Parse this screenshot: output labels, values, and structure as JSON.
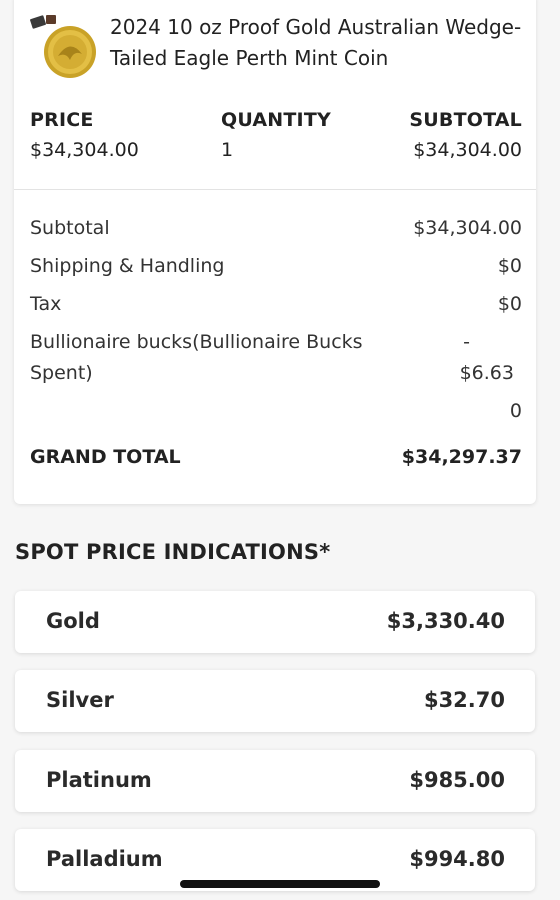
{
  "product": {
    "title": "2024 10 oz Proof Gold Australian Wedge-Tailed Eagle Perth Mint Coin",
    "image_icon": "gold-coin-icon"
  },
  "columns": {
    "price_label": "PRICE",
    "quantity_label": "QUANTITY",
    "subtotal_label": "SUBTOTAL",
    "price_value": "$34,304.00",
    "quantity_value": "1",
    "subtotal_value": "$34,304.00"
  },
  "summary": {
    "subtotal_label": "Subtotal",
    "subtotal_value": "$34,304.00",
    "shipping_label": "Shipping & Handling",
    "shipping_value": "$0",
    "tax_label": "Tax",
    "tax_value": "$0",
    "bucks_label_line1": "Bullionaire bucks(Bullionaire Bucks",
    "bucks_label_line2": "Spent)",
    "bucks_value_line1": "-",
    "bucks_value_line2": "$6.63",
    "bucks_value_line3": "0",
    "grand_total_label": "GRAND TOTAL",
    "grand_total_value": "$34,297.37"
  },
  "spot": {
    "heading": "SPOT PRICE INDICATIONS*",
    "items": [
      {
        "name": "Gold",
        "price": "$3,330.40"
      },
      {
        "name": "Silver",
        "price": "$32.70"
      },
      {
        "name": "Platinum",
        "price": "$985.00"
      },
      {
        "name": "Palladium",
        "price": "$994.80"
      }
    ]
  }
}
